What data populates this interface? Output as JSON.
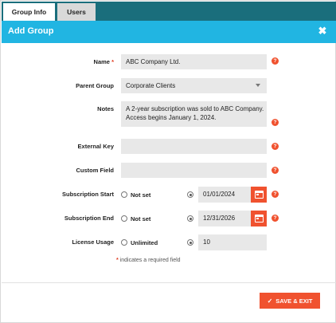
{
  "tabs": [
    {
      "label": "Group Info",
      "active": true
    },
    {
      "label": "Users",
      "active": false
    }
  ],
  "header": {
    "title": "Add Group",
    "close_icon": "close-icon"
  },
  "form": {
    "name": {
      "label": "Name",
      "required_mark": "*",
      "value": "ABC Company Ltd."
    },
    "parent_group": {
      "label": "Parent Group",
      "value": "Corporate Clients"
    },
    "notes": {
      "label": "Notes",
      "value": "A 2-year subscription was sold to ABC Company. Access begins January 1, 2024."
    },
    "external_key": {
      "label": "External Key",
      "value": ""
    },
    "custom_field": {
      "label": "Custom Field",
      "value": ""
    },
    "subscription_start": {
      "label": "Subscription Start",
      "not_set_label": "Not set",
      "value": "01/01/2024",
      "selected": "date"
    },
    "subscription_end": {
      "label": "Subscription End",
      "not_set_label": "Not set",
      "value": "12/31/2026",
      "selected": "date"
    },
    "license_usage": {
      "label": "License Usage",
      "unlimited_label": "Unlimited",
      "value": "10",
      "selected": "value"
    },
    "help_glyph": "?"
  },
  "required_note": {
    "mark": "*",
    "text": " indicates a required field"
  },
  "footer": {
    "save_label": "SAVE & EXIT",
    "check_glyph": "✓"
  },
  "colors": {
    "tab_bar": "#1a6e7c",
    "header": "#21b5e2",
    "accent": "#f0522f",
    "field_bg": "#e8e8e8"
  }
}
